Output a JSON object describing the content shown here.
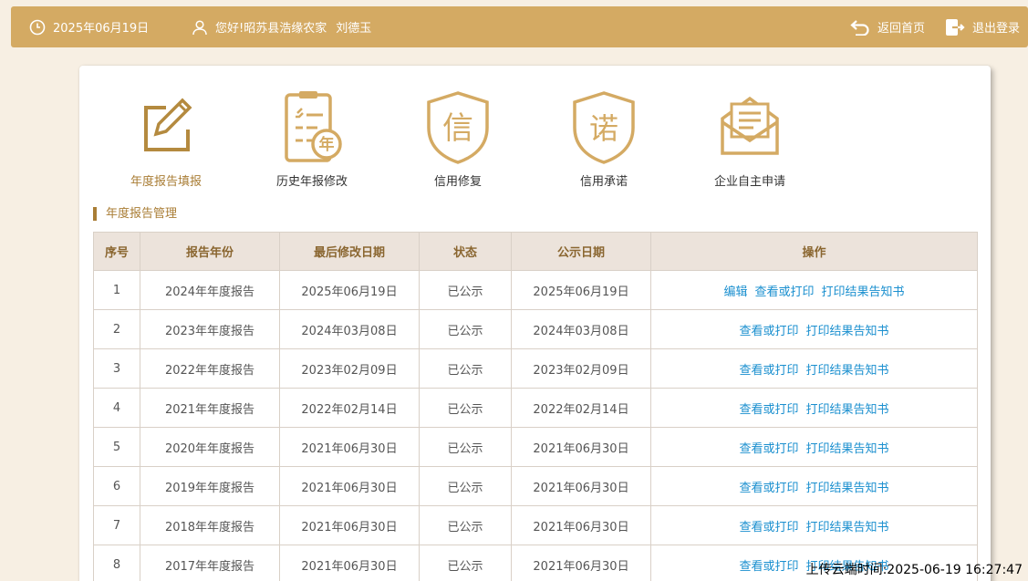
{
  "header": {
    "date": "2025年06月19日",
    "greeting": "您好!",
    "company": "昭苏县浩缘农家",
    "person": "刘德玉",
    "home_label": "返回首页",
    "logout_label": "退出登录"
  },
  "menu": [
    {
      "label": "年度报告填报",
      "icon": "pencil-edit-icon",
      "active": true
    },
    {
      "label": "历史年报修改",
      "icon": "clipboard-year-icon",
      "active": false
    },
    {
      "label": "信用修复",
      "icon": "shield-xin-icon",
      "active": false
    },
    {
      "label": "信用承诺",
      "icon": "shield-nuo-icon",
      "active": false
    },
    {
      "label": "企业自主申请",
      "icon": "envelope-icon",
      "active": false
    }
  ],
  "icon_chars": {
    "year": "年",
    "xin": "信",
    "nuo": "诺"
  },
  "section_title": "年度报告管理",
  "table": {
    "headers": [
      "序号",
      "报告年份",
      "最后修改日期",
      "状态",
      "公示日期",
      "操作"
    ],
    "rows": [
      {
        "no": "1",
        "year": "2024年年度报告",
        "modified": "2025年06月19日",
        "status": "已公示",
        "published": "2025年06月19日",
        "ops": [
          "编辑",
          "查看或打印",
          "打印结果告知书"
        ]
      },
      {
        "no": "2",
        "year": "2023年年度报告",
        "modified": "2024年03月08日",
        "status": "已公示",
        "published": "2024年03月08日",
        "ops": [
          "查看或打印",
          "打印结果告知书"
        ]
      },
      {
        "no": "3",
        "year": "2022年年度报告",
        "modified": "2023年02月09日",
        "status": "已公示",
        "published": "2023年02月09日",
        "ops": [
          "查看或打印",
          "打印结果告知书"
        ]
      },
      {
        "no": "4",
        "year": "2021年年度报告",
        "modified": "2022年02月14日",
        "status": "已公示",
        "published": "2022年02月14日",
        "ops": [
          "查看或打印",
          "打印结果告知书"
        ]
      },
      {
        "no": "5",
        "year": "2020年年度报告",
        "modified": "2021年06月30日",
        "status": "已公示",
        "published": "2021年06月30日",
        "ops": [
          "查看或打印",
          "打印结果告知书"
        ]
      },
      {
        "no": "6",
        "year": "2019年年度报告",
        "modified": "2021年06月30日",
        "status": "已公示",
        "published": "2021年06月30日",
        "ops": [
          "查看或打印",
          "打印结果告知书"
        ]
      },
      {
        "no": "7",
        "year": "2018年年度报告",
        "modified": "2021年06月30日",
        "status": "已公示",
        "published": "2021年06月30日",
        "ops": [
          "查看或打印",
          "打印结果告知书"
        ]
      },
      {
        "no": "8",
        "year": "2017年年度报告",
        "modified": "2021年06月30日",
        "status": "已公示",
        "published": "2021年06月30日",
        "ops": [
          "查看或打印",
          "打印结果告知书"
        ]
      }
    ]
  },
  "watermark": "上传云端时间:2025-06-19 16:27:47",
  "colors": {
    "gold": "#d4aa63",
    "accent": "#a97d35",
    "link": "#1a8fcf",
    "header_bg": "#ece3db"
  }
}
